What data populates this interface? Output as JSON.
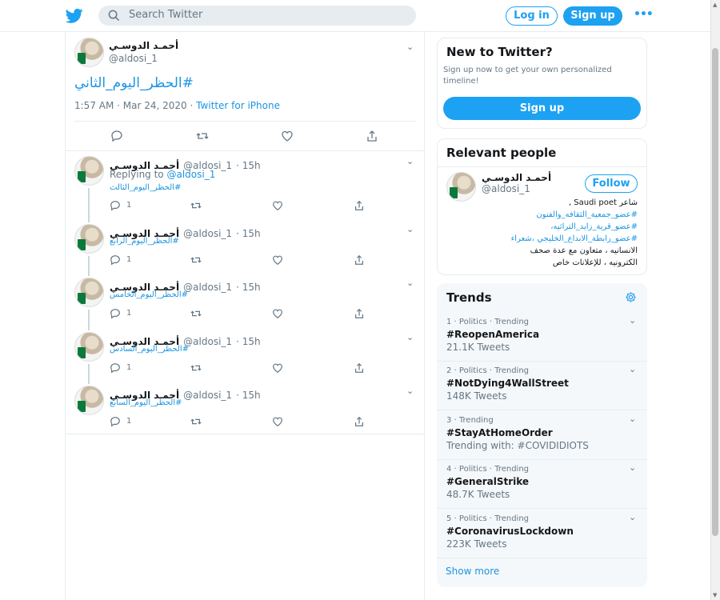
{
  "header": {
    "search_placeholder": "Search Twitter",
    "login_label": "Log in",
    "signup_label": "Sign up",
    "more_label": "•••"
  },
  "main_tweet": {
    "author_name": "أحمـد الدوسـي",
    "handle": "@aldosi_1",
    "hashtag": "#الحظر_اليوم_الثاني",
    "timestamp": "1:57 AM · Mar 24, 2020",
    "separator": " · ",
    "source": "Twitter for iPhone"
  },
  "replies": [
    {
      "author_name": "أحمـد الدوسـي",
      "handle": "@aldosi_1",
      "age": "· 15h",
      "replying_prefix": "Replying to ",
      "replying_to": "@aldosi_1",
      "hashtag": "#الحظر_اليوم_الثالث",
      "reply_count": "1"
    },
    {
      "author_name": "أحمـد الدوسـي",
      "handle": "@aldosi_1",
      "age": "· 15h",
      "hashtag": "#الحظر_اليوم_الرابع",
      "reply_count": "1"
    },
    {
      "author_name": "أحمـد الدوسـي",
      "handle": "@aldosi_1",
      "age": "· 15h",
      "hashtag": "#الحظر_اليوم_الخامس",
      "reply_count": "1"
    },
    {
      "author_name": "أحمـد الدوسـي",
      "handle": "@aldosi_1",
      "age": "· 15h",
      "hashtag": "#الحظر_اليوم_السادس",
      "reply_count": "1"
    },
    {
      "author_name": "أحمـد الدوسـي",
      "handle": "@aldosi_1",
      "age": "· 15h",
      "hashtag": "#الحظر_اليوم_السابع",
      "reply_count": "1"
    }
  ],
  "new_to_twitter": {
    "title": "New to Twitter?",
    "subtitle": "Sign up now to get your own personalized timeline!",
    "button": "Sign up"
  },
  "relevant_people": {
    "title": "Relevant people",
    "name": "أحمـد الدوسـي",
    "handle": "@aldosi_1",
    "follow_label": "Follow",
    "bio_lines": [
      {
        "text": "شاعر Saudi poet ,",
        "link": false
      },
      {
        "text": "#عضو_جمعية_الثقافه_والفنون",
        "link": true
      },
      {
        "text": "#عضو_قرية_زايد_التراثيه،",
        "link": true
      },
      {
        "text": "#عضو_رابطة_الابداع_الخليجي ،شعراء",
        "link": true
      },
      {
        "text": "الانسانيه ، متعاون مع عدة صحف",
        "link": false
      },
      {
        "text": "الكترونيه ، للإعلانات خاص",
        "link": false
      }
    ]
  },
  "trends": {
    "title": "Trends",
    "items": [
      {
        "meta": "1 · Politics · Trending",
        "name": "#ReopenAmerica",
        "count": "21.1K Tweets"
      },
      {
        "meta": "2 · Politics · Trending",
        "name": "#NotDying4WallStreet",
        "count": "148K Tweets"
      },
      {
        "meta": "3 · Trending",
        "name": "#StayAtHomeOrder",
        "count": "Trending with: #COVIDIDIOTS"
      },
      {
        "meta": "4 · Politics · Trending",
        "name": "#GeneralStrike",
        "count": "48.7K Tweets"
      },
      {
        "meta": "5 · Politics · Trending",
        "name": "#CoronavirusLockdown",
        "count": "223K Tweets"
      }
    ],
    "show_more": "Show more"
  },
  "colors": {
    "accent": "#1da1f2",
    "link": "#1b95e0",
    "muted": "#657786"
  }
}
